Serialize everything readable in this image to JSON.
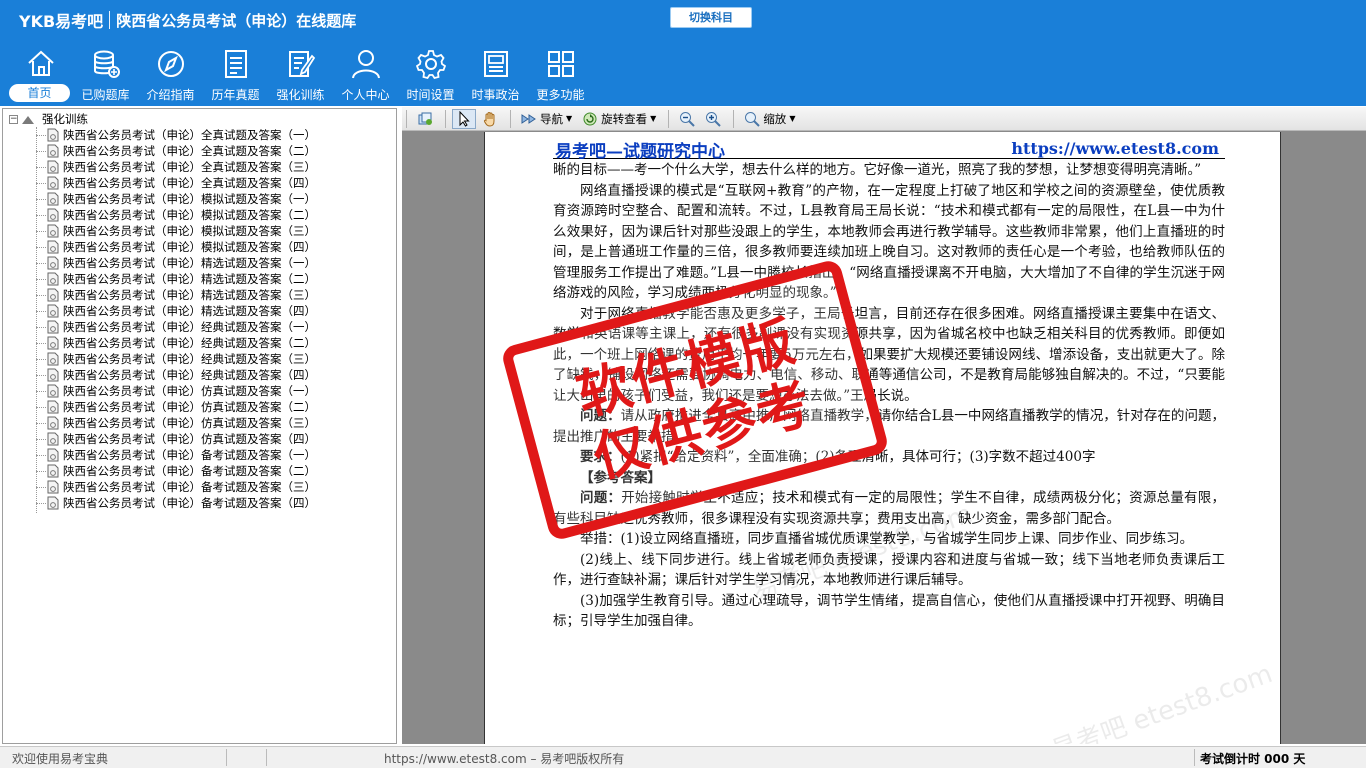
{
  "app": {
    "logo": "YKB易考吧",
    "title": "陕西省公务员考试（申论）在线题库",
    "switch_label": "切换科目",
    "colors": {
      "header_bg": "#1a7fd8",
      "accent_red": "#e01818",
      "doc_head_blue": "#0b3ec0"
    }
  },
  "nav": [
    {
      "label": "首页",
      "icon": "home-icon",
      "active": true
    },
    {
      "label": "已购题库",
      "icon": "database-add-icon"
    },
    {
      "label": "介绍指南",
      "icon": "compass-icon"
    },
    {
      "label": "历年真题",
      "icon": "document-list-icon"
    },
    {
      "label": "强化训练",
      "icon": "edit-document-icon"
    },
    {
      "label": "个人中心",
      "icon": "user-icon"
    },
    {
      "label": "时间设置",
      "icon": "gear-icon"
    },
    {
      "label": "时事政治",
      "icon": "news-icon"
    },
    {
      "label": "更多功能",
      "icon": "grid-icon"
    }
  ],
  "tree": {
    "root_expander": "−",
    "root_label": "强化训练",
    "items": [
      "陕西省公务员考试（申论）全真试题及答案（一）",
      "陕西省公务员考试（申论）全真试题及答案（二）",
      "陕西省公务员考试（申论）全真试题及答案（三）",
      "陕西省公务员考试（申论）全真试题及答案（四）",
      "陕西省公务员考试（申论）模拟试题及答案（一）",
      "陕西省公务员考试（申论）模拟试题及答案（二）",
      "陕西省公务员考试（申论）模拟试题及答案（三）",
      "陕西省公务员考试（申论）模拟试题及答案（四）",
      "陕西省公务员考试（申论）精选试题及答案（一）",
      "陕西省公务员考试（申论）精选试题及答案（二）",
      "陕西省公务员考试（申论）精选试题及答案（三）",
      "陕西省公务员考试（申论）精选试题及答案（四）",
      "陕西省公务员考试（申论）经典试题及答案（一）",
      "陕西省公务员考试（申论）经典试题及答案（二）",
      "陕西省公务员考试（申论）经典试题及答案（三）",
      "陕西省公务员考试（申论）经典试题及答案（四）",
      "陕西省公务员考试（申论）仿真试题及答案（一）",
      "陕西省公务员考试（申论）仿真试题及答案（二）",
      "陕西省公务员考试（申论）仿真试题及答案（三）",
      "陕西省公务员考试（申论）仿真试题及答案（四）",
      "陕西省公务员考试（申论）备考试题及答案（一）",
      "陕西省公务员考试（申论）备考试题及答案（二）",
      "陕西省公务员考试（申论）备考试题及答案（三）",
      "陕西省公务员考试（申论）备考试题及答案（四）"
    ]
  },
  "toolbar": {
    "nav_label": "导航",
    "rotate_label": "旋转查看",
    "zoom_label": "缩放"
  },
  "document": {
    "header_left": "易考吧—试题研究中心",
    "header_right": "https://www.etest8.com",
    "paragraphs": [
      {
        "indent": false,
        "text": "晰的目标——考一个什么大学，想去什么样的地方。它好像一道光，照亮了我的梦想，让梦想变得明亮清晰。”"
      },
      {
        "indent": true,
        "text": "网络直播授课的模式是“互联网+教育”的产物，在一定程度上打破了地区和学校之间的资源壁垒，使优质教育资源跨时空整合、配置和流转。不过，L县教育局王局长说：“技术和模式都有一定的局限性，在L县一中为什么效果好，因为课后针对那些没跟上的学生，本地教师会再进行教学辅导。这些教师非常累，他们上直播班的时间，是上普通班工作量的三倍，很多教师要连续加班上晚自习。这对教师的责任心是一个考验，也给教师队伍的管理服务工作提出了难题。”L县一中滕校长指出：“网络直播授课离不开电脑，大大增加了不自律的学生沉迷于网络游戏的风险，学习成绩两极分化明显的现象。”"
      },
      {
        "indent": true,
        "text": "对于网络直播教学能否惠及更多学子，王局长坦言，目前还存在很多困难。网络直播授课主要集中在语文、数学和英语课等主课上，还有很多副课没有实现资源共享，因为省城名校中也缺乏相关科目的优秀教师。即便如此，一个班上网络课的费用平均一年要5万元左右，如果要扩大规模还要铺设网线、增添设备，支出就更大了。除了缺钱，铺设网络还需要协调电力、电信、移动、联通等通信公司，不是教育局能够独自解决的。不过，“只要能让大山里的孩子们受益，我们还是要想办法去做。”王局长说。"
      },
      {
        "indent": true,
        "lead": "问题：",
        "text": "请从政府推进全县高中推广网络直播教学，请你结合L县一中网络直播教学的情况，针对存在的问题，提出推广的主要举措。"
      },
      {
        "indent": true,
        "lead": "要求：",
        "text": "(1)紧扣“给定资料”，全面准确；(2)条理清晰，具体可行；(3)字数不超过400字"
      },
      {
        "indent": true,
        "lead": "【参考答案】",
        "text": ""
      },
      {
        "indent": true,
        "lead": "问题：",
        "text": "开始接触时学生不适应；技术和模式有一定的局限性；学生不自律，成绩两极分化；资源总量有限，有些科目缺乏优秀教师，很多课程没有实现资源共享；费用支出高，缺少资金，需多部门配合。"
      },
      {
        "indent": true,
        "text": "举措：(1)设立网络直播班，同步直播省城优质课堂教学，与省城学生同步上课、同步作业、同步练习。"
      },
      {
        "indent": true,
        "text": "(2)线上、线下同步进行。线上省城老师负责授课，授课内容和进度与省城一致；线下当地老师负责课后工作，进行查缺补漏；课后针对学生学习情况，本地教师进行课后辅导。"
      },
      {
        "indent": true,
        "text": "(3)加强学生教育引导。通过心理疏导，调节学生情绪，提高自信心，使他们从直播授课中打开视野、明确目标；引导学生加强自律。"
      }
    ],
    "stamp_line1": "软件模版",
    "stamp_line2": "仅供参考",
    "faint_watermark": "易考吧 etest8.com"
  },
  "status": {
    "left": "欢迎使用易考宝典",
    "center": "https://www.etest8.com – 易考吧版权所有",
    "right": "考试倒计时 000 天"
  }
}
